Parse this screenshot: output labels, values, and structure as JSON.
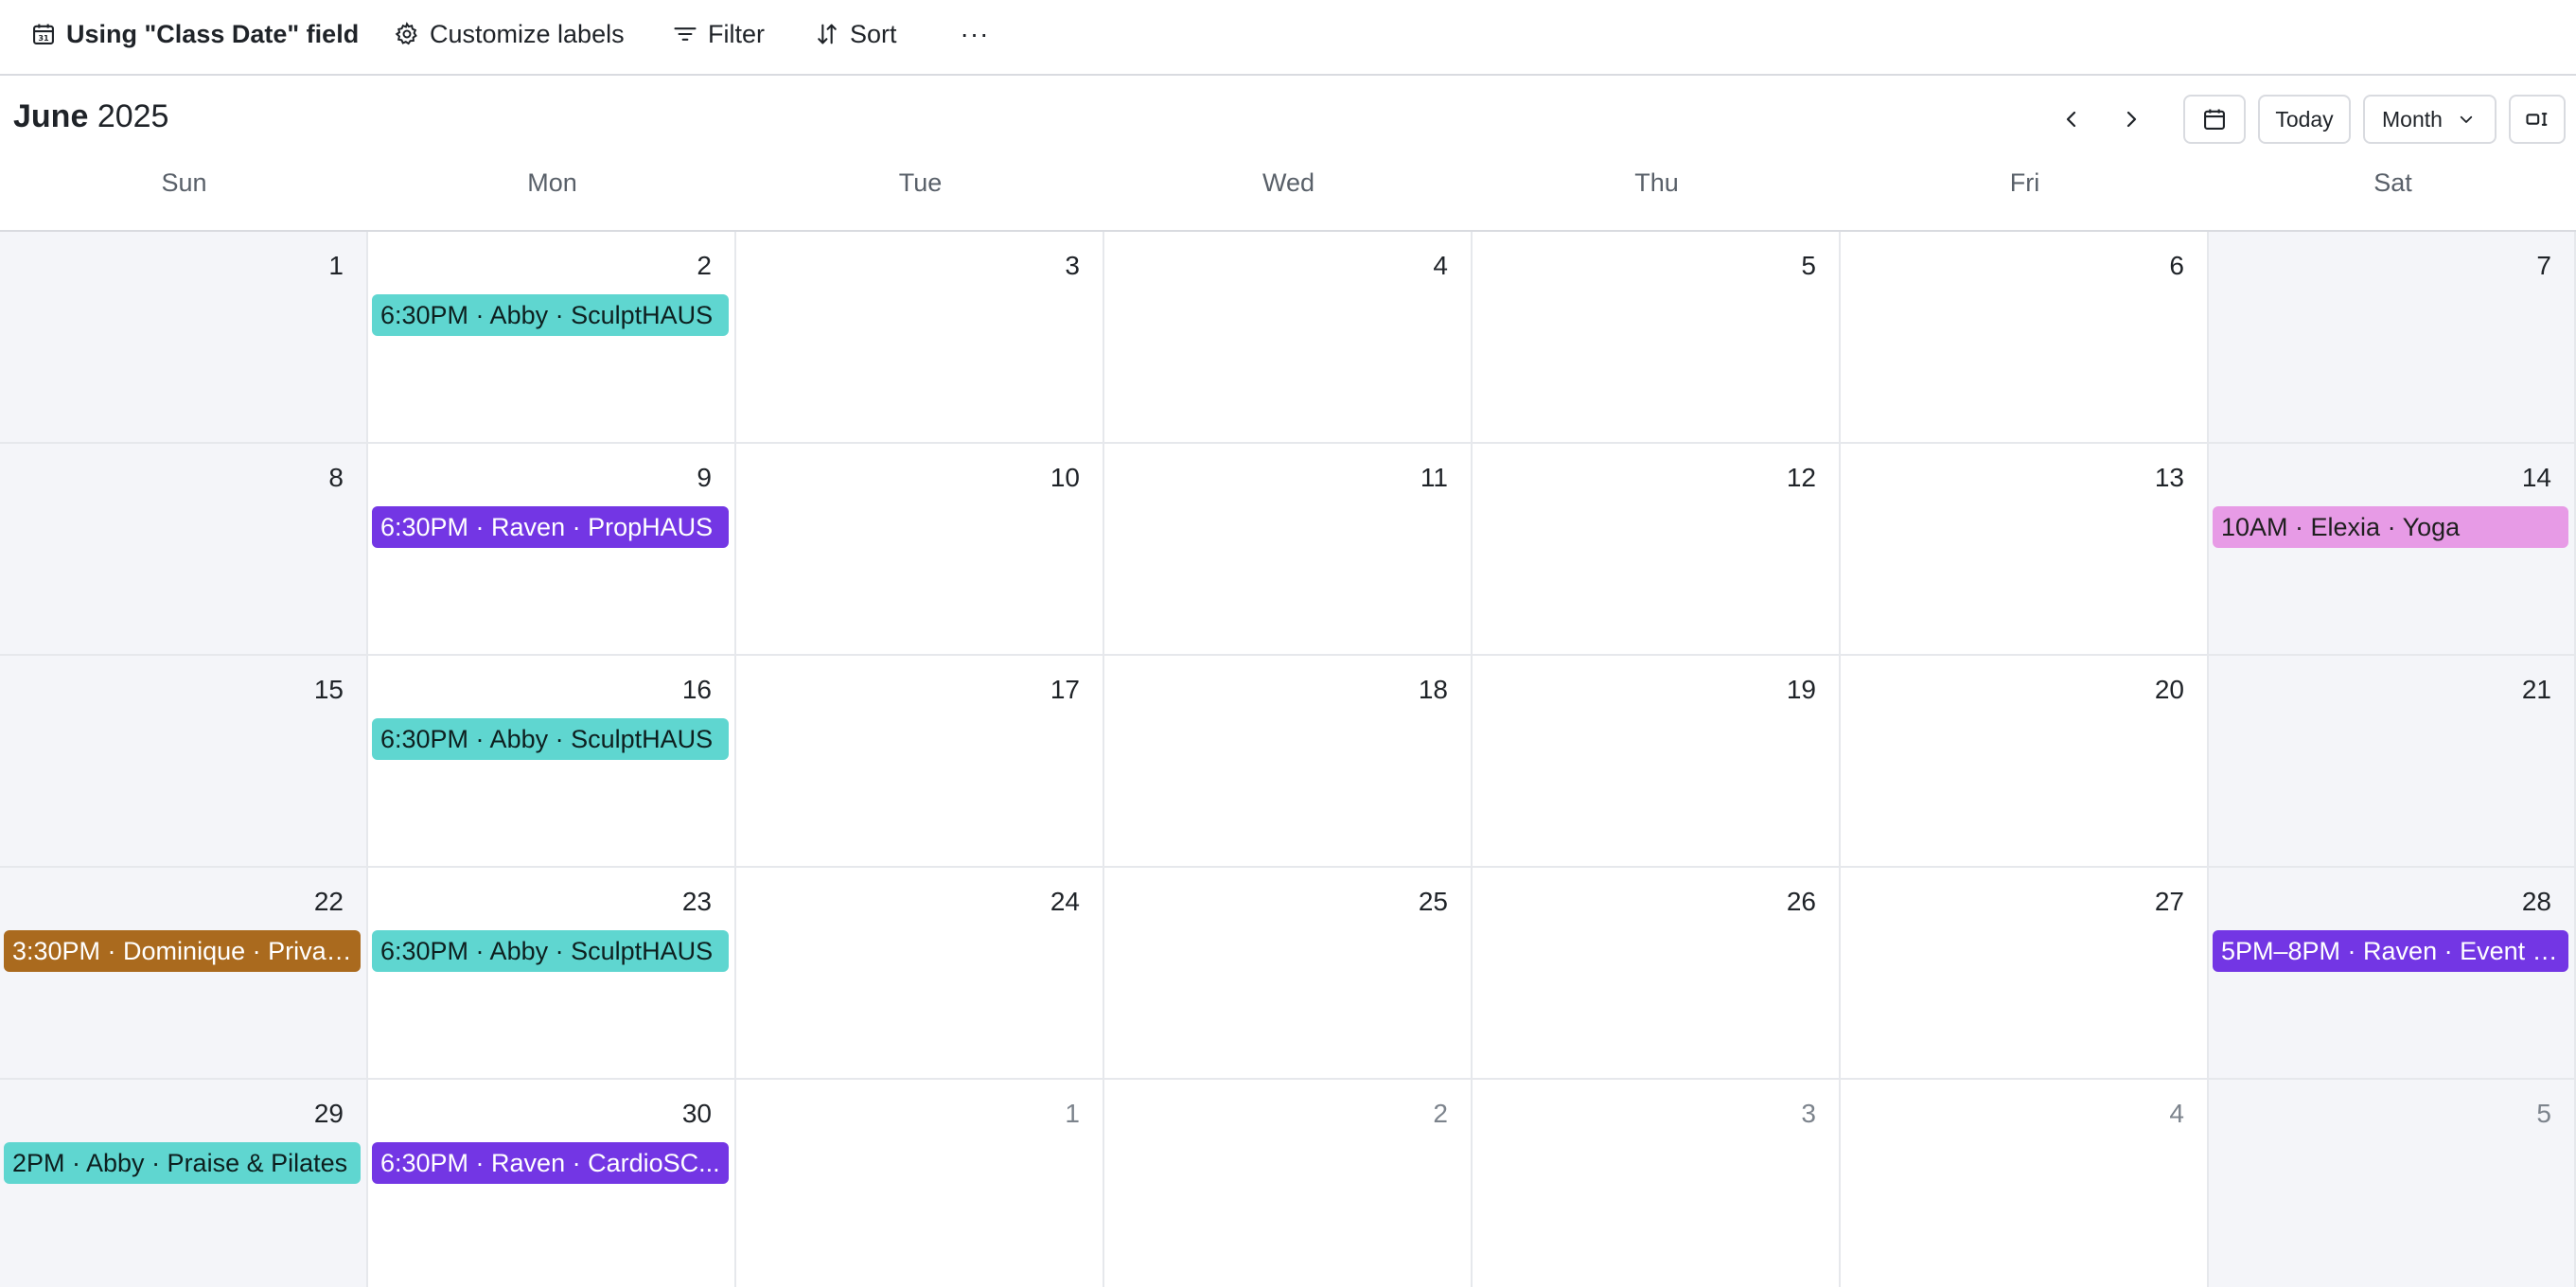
{
  "toolbar": {
    "date_field": "Using \"Class Date\" field",
    "customize_labels": "Customize labels",
    "filter": "Filter",
    "sort": "Sort",
    "more": "···"
  },
  "header": {
    "month": "June",
    "year": "2025",
    "today": "Today",
    "view_mode": "Month"
  },
  "weekdays": [
    "Sun",
    "Mon",
    "Tue",
    "Wed",
    "Thu",
    "Fri",
    "Sat"
  ],
  "weeks": [
    [
      {
        "day": "1"
      },
      {
        "day": "2",
        "event": "6:30PM · Abby · SculptHAUS",
        "color": "teal"
      },
      {
        "day": "3"
      },
      {
        "day": "4"
      },
      {
        "day": "5"
      },
      {
        "day": "6"
      },
      {
        "day": "7"
      }
    ],
    [
      {
        "day": "8"
      },
      {
        "day": "9",
        "event": "6:30PM · Raven · PropHAUS",
        "color": "purple"
      },
      {
        "day": "10"
      },
      {
        "day": "11"
      },
      {
        "day": "12"
      },
      {
        "day": "13"
      },
      {
        "day": "14",
        "event": "10AM · Elexia · Yoga",
        "color": "pink"
      }
    ],
    [
      {
        "day": "15"
      },
      {
        "day": "16",
        "event": "6:30PM · Abby · SculptHAUS",
        "color": "teal"
      },
      {
        "day": "17"
      },
      {
        "day": "18"
      },
      {
        "day": "19"
      },
      {
        "day": "20"
      },
      {
        "day": "21"
      }
    ],
    [
      {
        "day": "22",
        "event": "3:30PM · Dominique · Privat...",
        "color": "brown"
      },
      {
        "day": "23",
        "event": "6:30PM · Abby · SculptHAUS",
        "color": "teal"
      },
      {
        "day": "24"
      },
      {
        "day": "25"
      },
      {
        "day": "26"
      },
      {
        "day": "27"
      },
      {
        "day": "28",
        "event": "5PM–8PM · Raven · Event w...",
        "color": "purple"
      }
    ],
    [
      {
        "day": "29",
        "event": "2PM · Abby · Praise & Pilates",
        "color": "teal"
      },
      {
        "day": "30",
        "event": "6:30PM · Raven · CardioSC...",
        "color": "purple"
      },
      {
        "day": "1",
        "other_month": true
      },
      {
        "day": "2",
        "other_month": true
      },
      {
        "day": "3",
        "other_month": true
      },
      {
        "day": "4",
        "other_month": true
      },
      {
        "day": "5",
        "other_month": true
      }
    ]
  ],
  "colors": {
    "teal": "#5fd6d0",
    "purple": "#7336e4",
    "pink": "#e79be6",
    "brown": "#aa6a1e"
  }
}
